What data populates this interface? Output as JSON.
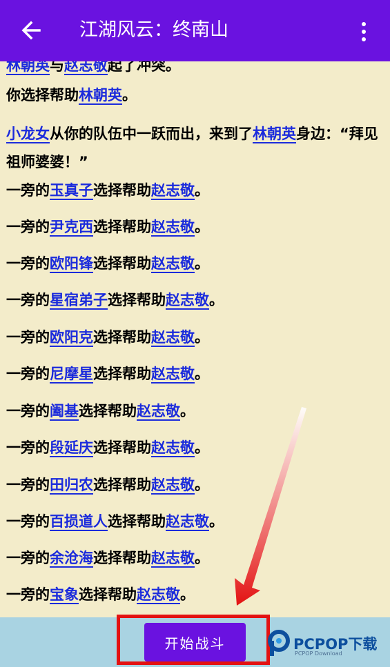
{
  "appbar": {
    "title": "江湖风云：终南山",
    "back_icon": "arrow-back-icon",
    "menu_icon": "more-vertical-icon"
  },
  "story": {
    "lines": [
      {
        "parts": [
          "林朝英",
          "与",
          "赵志敬",
          "起了冲突。"
        ],
        "links": [
          0,
          2
        ]
      },
      {
        "parts": [
          "你选择帮助",
          "林朝英",
          "。"
        ],
        "links": [
          1
        ]
      },
      {
        "parts": [
          "小龙女",
          "从你的队伍中一跃而出，来到了",
          "林朝英",
          "身边：“拜见祖师婆婆！”"
        ],
        "links": [
          0,
          2
        ]
      },
      {
        "parts": [
          "一旁的",
          "玉真子",
          "选择帮助",
          "赵志敬",
          "。"
        ],
        "links": [
          1,
          3
        ]
      },
      {
        "parts": [
          "一旁的",
          "尹克西",
          "选择帮助",
          "赵志敬",
          "。"
        ],
        "links": [
          1,
          3
        ]
      },
      {
        "parts": [
          "一旁的",
          "欧阳锋",
          "选择帮助",
          "赵志敬",
          "。"
        ],
        "links": [
          1,
          3
        ]
      },
      {
        "parts": [
          "一旁的",
          "星宿弟子",
          "选择帮助",
          "赵志敬",
          "。"
        ],
        "links": [
          1,
          3
        ]
      },
      {
        "parts": [
          "一旁的",
          "欧阳克",
          "选择帮助",
          "赵志敬",
          "。"
        ],
        "links": [
          1,
          3
        ]
      },
      {
        "parts": [
          "一旁的",
          "尼摩星",
          "选择帮助",
          "赵志敬",
          "。"
        ],
        "links": [
          1,
          3
        ]
      },
      {
        "parts": [
          "一旁的",
          "阖基",
          "选择帮助",
          "赵志敬",
          "。"
        ],
        "links": [
          1,
          3
        ]
      },
      {
        "parts": [
          "一旁的",
          "段延庆",
          "选择帮助",
          "赵志敬",
          "。"
        ],
        "links": [
          1,
          3
        ]
      },
      {
        "parts": [
          "一旁的",
          "田归农",
          "选择帮助",
          "赵志敬",
          "。"
        ],
        "links": [
          1,
          3
        ]
      },
      {
        "parts": [
          "一旁的",
          "百损道人",
          "选择帮助",
          "赵志敬",
          "。"
        ],
        "links": [
          1,
          3
        ]
      },
      {
        "parts": [
          "一旁的",
          "余沧海",
          "选择帮助",
          "赵志敬",
          "。"
        ],
        "links": [
          1,
          3
        ]
      },
      {
        "parts": [
          "一旁的",
          "宝象",
          "选择帮助",
          "赵志敬",
          "。"
        ],
        "links": [
          1,
          3
        ]
      }
    ]
  },
  "footer": {
    "start_button_label": "开始战斗"
  },
  "watermark": {
    "brand": "PCPOP下载",
    "sub": "PCPOP Download"
  },
  "colors": {
    "accent": "#6a12e0",
    "link": "#1b2bdc",
    "background": "#f3ecca",
    "footer": "#a9d3e2",
    "highlight": "#e31212"
  }
}
